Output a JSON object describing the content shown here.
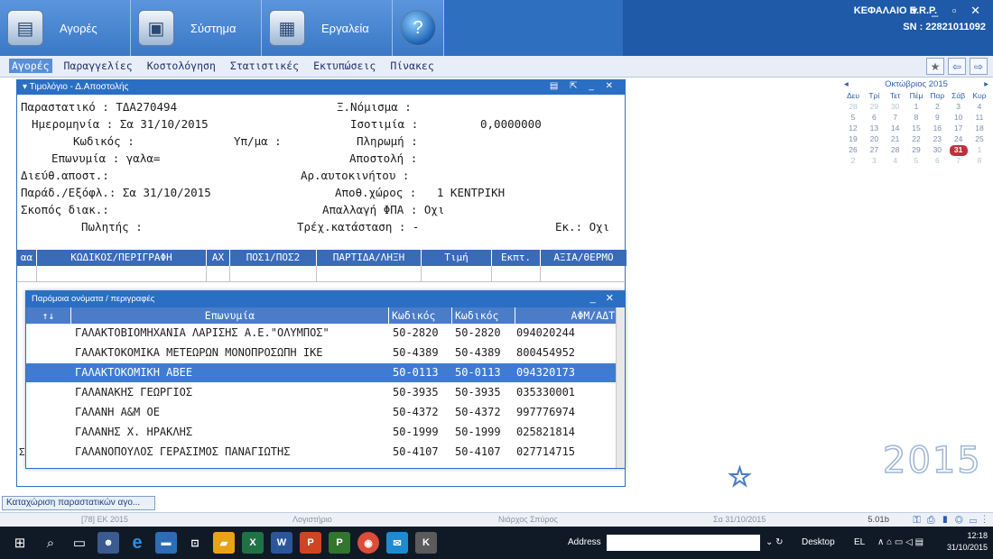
{
  "header": {
    "modules": [
      {
        "label": "Αγορές",
        "icon": "purchases-icon"
      },
      {
        "label": "Σύστημα",
        "icon": "system-icon"
      },
      {
        "label": "Εργαλεία",
        "icon": "calculator-icon"
      },
      {
        "label": "",
        "icon": "help-icon"
      }
    ],
    "company": "ΚΕΦΑΛΑΙΟ E.R.P.",
    "sn": "SN : 22821011092",
    "window_controls": "▾ _ ▫ ✕"
  },
  "menu": [
    "Αγορές",
    "Παραγγελίες",
    "Κοστολόγηση",
    "Στατιστικές",
    "Εκτυπώσεις",
    "Πίνακες"
  ],
  "invoice": {
    "title": "▾ Τιμολόγιο - Δ.Αποστολής",
    "title_controls": "▤ ⇱ _ ✕",
    "fields": {
      "doc": "Παραστατικό : ΤΔΑ270494",
      "date": "Ημερομηνία : Σα 31/10/2015",
      "code": "Κωδικός :",
      "branch": "Υπ/μα :",
      "name": "Επωνυμία : γαλα=",
      "addr": "Διεύθ.αποστ.:",
      "deliv": "Παράδ./Εξόφλ.: Σα 31/10/2015",
      "purpose": "Σκοπός διακ.:",
      "seller": "Πωλητής :",
      "currency": "Ξ.Νόμισμα :",
      "rate_label": "Ισοτιμία :",
      "rate_value": "0,0000000",
      "payment": "Πληρωμή :",
      "shipment": "Αποστολή :",
      "vehicle": "Αρ.αυτοκινήτου :",
      "warehouse": "Αποθ.χώρος :   1 ΚΕΝΤΡΙΚΗ",
      "vat_exempt": "Απαλλαγή ΦΠΑ : Οχι",
      "status": "Τρέχ.κατάσταση : -",
      "ek": "Εκ.: Οχι"
    },
    "columns": [
      "αα",
      "ΚΩΔΙΚΟΣ/ΠΕΡΙΓΡΑΦΗ",
      "ΑΧ",
      "ΠΟΣ1/ΠΟΣ2",
      "ΠΑΡΤΙΔΑ/ΛΗΞΗ",
      "Τιμή",
      "Εκπτ.",
      "ΑΞΙΑ/ΘΕΡΜΟ"
    ],
    "side_marker": "Σ"
  },
  "popup": {
    "title": "Παρόμοια ονόματα / περιγραφές",
    "controls": "_ ✕",
    "sort_icon": "↑↓",
    "headers": [
      "Επωνυμία",
      "Κωδικός",
      "Κωδικός",
      "ΑΦΜ/ΑΔΤ"
    ],
    "rows": [
      {
        "name": "ΓΑΛΑΚΤΟΒΙΟΜΗΧΑΝΙΑ ΛΑΡΙΣΗΣ Α.Ε.\"ΟΛΥΜΠΟΣ\"",
        "code1": "50-2820",
        "code2": "50-2820",
        "afm": "094020244"
      },
      {
        "name": "ΓΑΛΑΚΤΟΚΟΜΙΚΑ ΜΕΤΕΩΡΩΝ ΜΟΝΟΠΡΟΣΩΠΗ ΙΚΕ",
        "code1": "50-4389",
        "code2": "50-4389",
        "afm": "800454952"
      },
      {
        "name": "ΓΑΛΑΚΤΟΚΟΜΙΚΗ  ΑΒΕΕ",
        "code1": "50-0113",
        "code2": "50-0113",
        "afm": "094320173"
      },
      {
        "name": "ΓΑΛΑΝΑΚΗΣ ΓΕΩΡΓΙΟΣ",
        "code1": "50-3935",
        "code2": "50-3935",
        "afm": "035330001"
      },
      {
        "name": "ΓΑΛΑΝΗ Α&Μ ΟΕ",
        "code1": "50-4372",
        "code2": "50-4372",
        "afm": "997776974"
      },
      {
        "name": "ΓΑΛΑΝΗΣ Χ. ΗΡΑΚΛΗΣ",
        "code1": "50-1999",
        "code2": "50-1999",
        "afm": "025821814"
      },
      {
        "name": "ΓΑΛΑΝΟΠΟΥΛΟΣ  ΓΕΡΑΣΙΜΟΣ ΠΑΝΑΓΙΩΤΗΣ",
        "code1": "50-4107",
        "code2": "50-4107",
        "afm": "027714715"
      }
    ],
    "selected_index": 2
  },
  "calendar": {
    "month": "Οκτώβριος 2015",
    "prev": "◂",
    "next": "▸",
    "dow": [
      "Δευ",
      "Τρί",
      "Τετ",
      "Πέμ",
      "Παρ",
      "Σάβ",
      "Κυρ"
    ],
    "weeks": [
      [
        "28",
        "29",
        "30",
        "1",
        "2",
        "3",
        "4"
      ],
      [
        "5",
        "6",
        "7",
        "8",
        "9",
        "10",
        "11"
      ],
      [
        "12",
        "13",
        "14",
        "15",
        "16",
        "17",
        "18"
      ],
      [
        "19",
        "20",
        "21",
        "22",
        "23",
        "24",
        "25"
      ],
      [
        "26",
        "27",
        "28",
        "29",
        "30",
        "31",
        "1"
      ],
      [
        "2",
        "3",
        "4",
        "5",
        "6",
        "7",
        "8"
      ]
    ],
    "today": "31",
    "year_big": "2015"
  },
  "taskbar_tab": "Καταχώριση παραστατικών αγο...",
  "status": {
    "period": "[78] ΕΚ 2015",
    "dept": "Λογιστήριο",
    "user": "Νιάρχος Σπύρος",
    "date": "Σα 31/10/2015",
    "version": "5.01b"
  },
  "taskbar": {
    "address_label": "Address",
    "desktop_label": "Desktop",
    "lang": "EL",
    "time": "12:18",
    "date": "31/10/2015"
  },
  "colors": {
    "header_blue": "#2f6fc0",
    "selected_row": "#3f7bd0",
    "today": "#c0303b"
  }
}
